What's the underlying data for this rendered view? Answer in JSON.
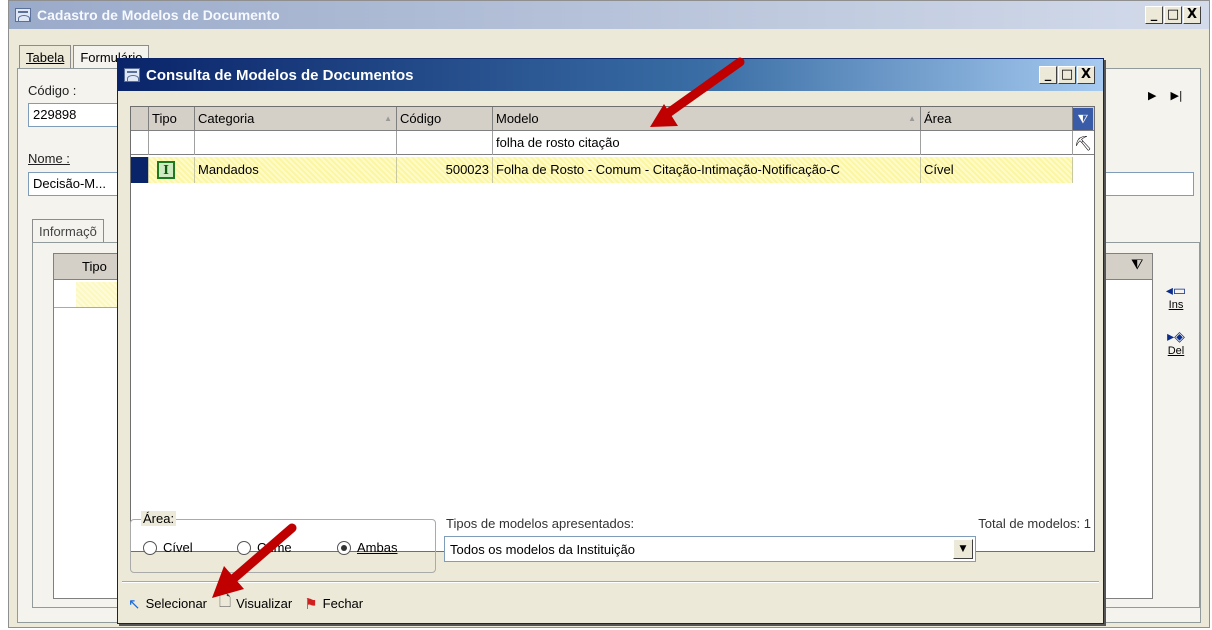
{
  "background_window": {
    "title": "Cadastro de Modelos de Documento",
    "window_buttons": [
      "_",
      "□",
      "X"
    ],
    "tabs": [
      "Tabela",
      "Formulário"
    ],
    "codigo_label": "Código :",
    "codigo_value": "229898",
    "nome_label": "Nome :",
    "nome_value": "Decisão-M...",
    "nav": [
      "▶",
      "▶|"
    ],
    "subtab": "Informaçõ",
    "inner_grid_header": "Tipo",
    "ins_label": "Ins",
    "del_label": "Del"
  },
  "dialog": {
    "title": "Consulta de Modelos de Documentos",
    "window_buttons": [
      "_",
      "□",
      "X"
    ],
    "grid": {
      "columns": [
        "Tipo",
        "Categoria",
        "Código",
        "Modelo",
        "Área"
      ],
      "filter": {
        "modelo": "folha de rosto citação"
      },
      "rows": [
        {
          "tipo": "I",
          "categoria": "Mandados",
          "codigo": "500023",
          "modelo": "Folha de Rosto - Comum - Citação-Intimação-Notificação-C",
          "area": "Cível"
        }
      ]
    },
    "area_group": {
      "legend": "Área:",
      "options": [
        "Cível",
        "Crime",
        "Ambas"
      ],
      "selected": "Ambas"
    },
    "tipos_label": "Tipos de modelos apresentados:",
    "tipos_value": "Todos os modelos da Instituição",
    "total_label": "Total de modelos: 1",
    "footer_buttons": [
      "Selecionar",
      "Visualizar",
      "Fechar"
    ]
  },
  "colors": {
    "title_gradient_start": "#0a246a",
    "row_highlight": "#fbf6a2",
    "annotation_arrow": "#c00000"
  }
}
